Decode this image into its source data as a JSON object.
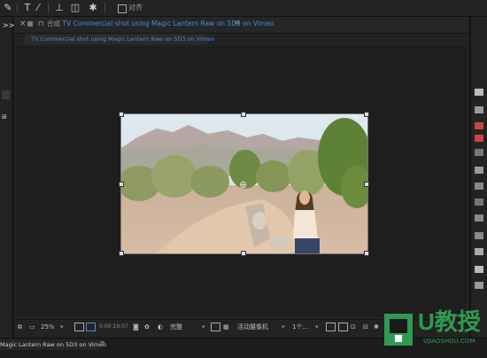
{
  "toolbar": {
    "snap_label": "对齐",
    "icons": [
      "pen-tool-icon",
      "text-tool-icon",
      "brush-tool-icon",
      "stamp-tool-icon",
      "eraser-tool-icon",
      "puppet-tool-icon"
    ]
  },
  "left_panel": {
    "chevrons": ">>"
  },
  "composition": {
    "title_prefix": "合成",
    "title": "TV Commercial shot using Magic Lantern Raw on 5D3 on Vimeo",
    "tab_label": "TV Commercial shot using Magic Lantern Raw on 5D3 on Vimeo",
    "menu_glyph": "≡"
  },
  "viewer_bar": {
    "zoom": "25%",
    "timecode": "0:00:19:07",
    "resolution": "完整",
    "camera": "活动摄像机",
    "views": "1个..."
  },
  "timeline": {
    "tab_label": "Magic Lantern Raw on 5D3 on Vimeo",
    "menu_glyph": "≡"
  },
  "watermark": {
    "brand": "U教授",
    "url": "UJIAOSHOU.COM"
  },
  "colors": {
    "accent_blue": "#3f8edc",
    "watermark_green": "#2f9a52",
    "panel_bg": "#232323"
  }
}
